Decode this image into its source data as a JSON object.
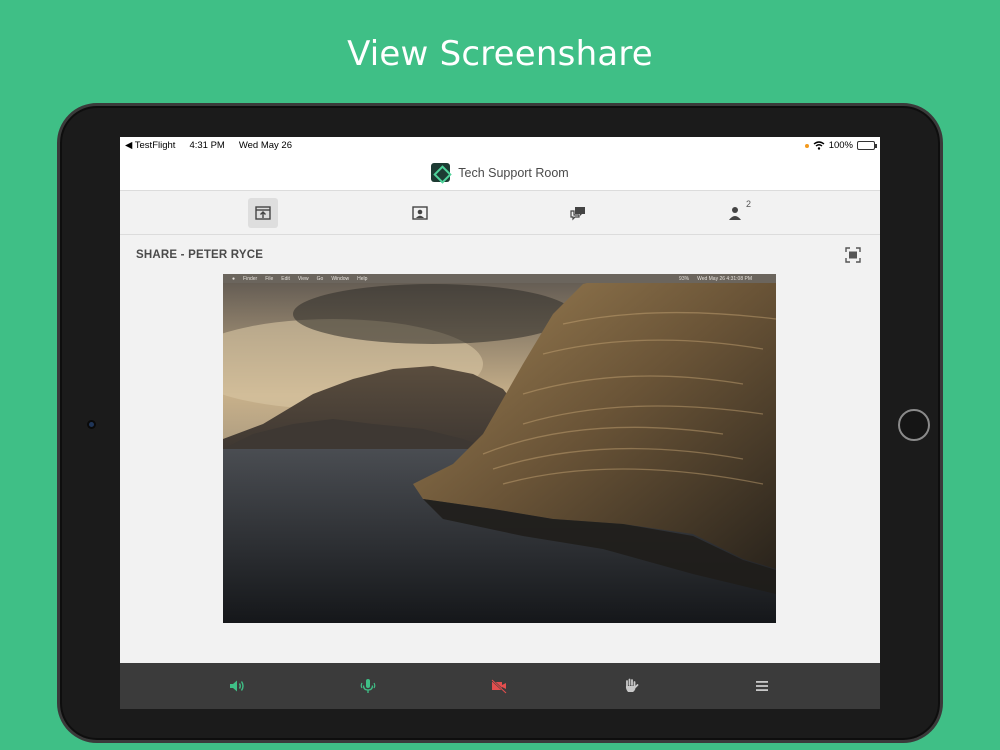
{
  "promo": {
    "title": "View Screenshare"
  },
  "status_bar": {
    "back_app": "◀ TestFlight",
    "time": "4:31 PM",
    "date": "Wed May 26",
    "battery": "100%"
  },
  "room": {
    "title": "Tech Support Room"
  },
  "tabs": [
    {
      "name": "share",
      "active": true,
      "icon": "share-pod-icon"
    },
    {
      "name": "camera",
      "active": false,
      "icon": "camera-pod-icon"
    },
    {
      "name": "chat",
      "active": false,
      "icon": "chat-pod-icon"
    },
    {
      "name": "attendees",
      "active": false,
      "icon": "attendees-pod-icon",
      "badge": "2"
    }
  ],
  "share": {
    "header": "SHARE - PETER RYCE"
  },
  "shared_screen": {
    "menubar": {
      "app": "Finder",
      "items": [
        "File",
        "Edit",
        "View",
        "Go",
        "Window",
        "Help"
      ],
      "clock": "Wed May 26  4:31:08 PM",
      "battery": "93%"
    }
  },
  "toolbar": {
    "speaker_color": "#3fbf86",
    "mic_color": "#3fbf86",
    "camera_color": "#e24e4e",
    "hand_color": "#c8c8c8",
    "menu_color": "#c8c8c8"
  }
}
